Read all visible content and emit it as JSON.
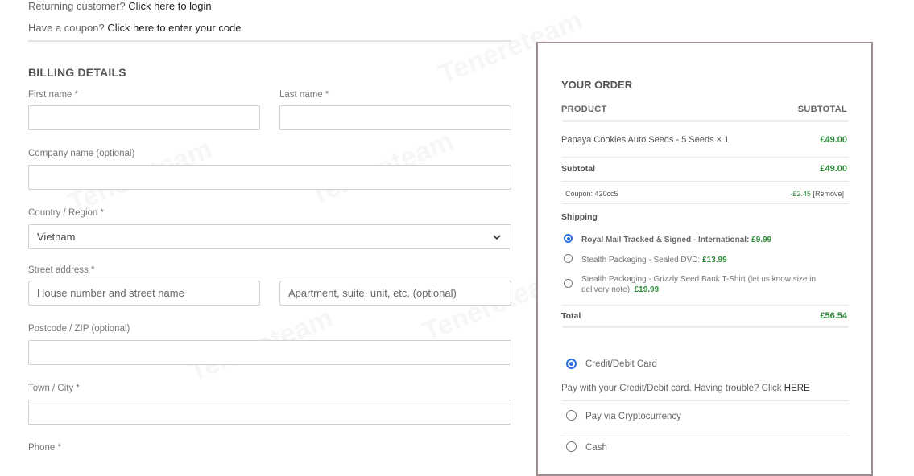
{
  "notices": {
    "returning_prefix": "Returning customer?",
    "returning_link": "Click here to login",
    "coupon_prefix": "Have a coupon?",
    "coupon_link": "Click here to enter your code"
  },
  "billing": {
    "title": "BILLING DETAILS",
    "first_name_label": "First name *",
    "last_name_label": "Last name *",
    "company_label": "Company name (optional)",
    "country_label": "Country / Region *",
    "country_value": "Vietnam",
    "street_label": "Street address *",
    "street_placeholder": "House number and street name",
    "apartment_placeholder": "Apartment, suite, unit, etc. (optional)",
    "postcode_label": "Postcode / ZIP (optional)",
    "city_label": "Town / City *",
    "phone_label": "Phone *"
  },
  "order": {
    "title": "YOUR ORDER",
    "col_product": "PRODUCT",
    "col_subtotal": "SUBTOTAL",
    "item_name": "Papaya Cookies Auto Seeds - 5 Seeds  × 1",
    "item_price": "£49.00",
    "subtotal_label": "Subtotal",
    "subtotal_value": "£49.00",
    "coupon_label": "Coupon: 420cc5",
    "coupon_value": "-£2.45",
    "coupon_remove": "[Remove]",
    "shipping_label": "Shipping",
    "shipping_options": [
      {
        "label": "Royal Mail Tracked & Signed - International:",
        "price": "£9.99",
        "selected": true
      },
      {
        "label": "Stealth Packaging - Sealed DVD:",
        "price": "£13.99",
        "selected": false
      },
      {
        "label": "Stealth Packaging - Grizzly Seed Bank T-Shirt (let us know size in delivery note):",
        "price": "£19.99",
        "selected": false
      }
    ],
    "total_label": "Total",
    "total_value": "£56.54"
  },
  "payment": {
    "card_label": "Credit/Debit Card",
    "card_desc": "Pay with your Credit/Debit card. Having trouble? Click",
    "card_desc_link": "HERE",
    "crypto_label": "Pay via Cryptocurrency",
    "cash_label": "Cash"
  },
  "watermark": "Tenereteam",
  "colors": {
    "price_green": "#2e8b3a",
    "radio_blue": "#2a6fdb",
    "order_border": "#9e8f8f"
  }
}
